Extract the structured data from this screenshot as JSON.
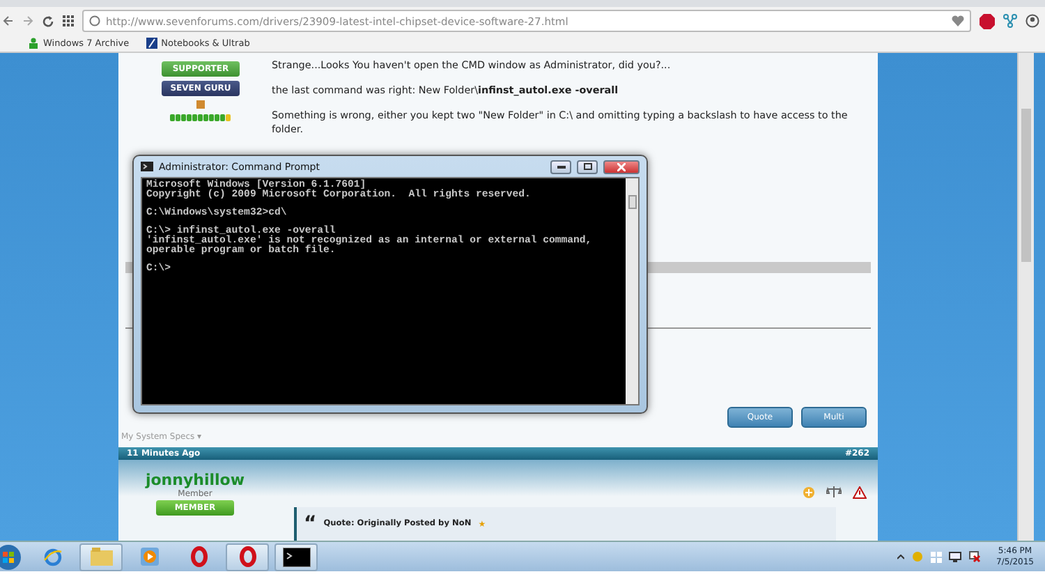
{
  "browser": {
    "url": "http://www.sevenforums.com/drivers/23909-latest-intel-chipset-device-software-27.html",
    "bookmarks": [
      {
        "label": "Windows 7 Archive",
        "kind": "green"
      },
      {
        "label": "Notebooks & Ultrab",
        "kind": "blue"
      }
    ]
  },
  "post": {
    "badges": [
      {
        "label": "SUPPORTER",
        "kind": "supporter"
      },
      {
        "label": "SEVEN GURU",
        "kind": "guru"
      }
    ],
    "paragraphs": [
      "Strange...Looks You haven't open the CMD window as Administrator, did you?...",
      "the last command was right: New Folder\\**infinst_autol.exe -overall**",
      "Something is wrong, either you kept two \"New Folder\" in C:\\ and omitting typing a backslash to have access to the folder."
    ],
    "buttons": [
      "Quote",
      "Multi"
    ],
    "specs": "My System Specs",
    "specs_caret": "▾"
  },
  "next_post": {
    "time": "11 Minutes Ago",
    "number": "#262",
    "username": "jonnyhillow",
    "role": "Member",
    "badge": "MEMBER",
    "quote_mark": "“",
    "quote_title": "Quote: Originally Posted by NoN",
    "quote_star": "★"
  },
  "cmd": {
    "title": "Administrator: Command Prompt",
    "blocks": [
      [
        "Microsoft Windows [Version 6.1.7601]",
        "Copyright (c) 2009 Microsoft Corporation.  All rights reserved."
      ],
      [
        "C:\\Windows\\system32>cd\\"
      ],
      [
        "C:\\> infinst_autol.exe -overall",
        "'infinst_autol.exe' is not recognized as an internal or external command,",
        "operable program or batch file."
      ],
      [
        "C:\\>"
      ]
    ]
  },
  "taskbar": {
    "apps": [
      {
        "kind": "ie",
        "running": false
      },
      {
        "kind": "folder",
        "running": true
      },
      {
        "kind": "media",
        "running": false
      },
      {
        "kind": "opera",
        "running": false
      },
      {
        "kind": "opera",
        "running": true
      },
      {
        "kind": "cmd",
        "running": true
      }
    ],
    "time": "5:46 PM",
    "date": "7/5/2015"
  }
}
